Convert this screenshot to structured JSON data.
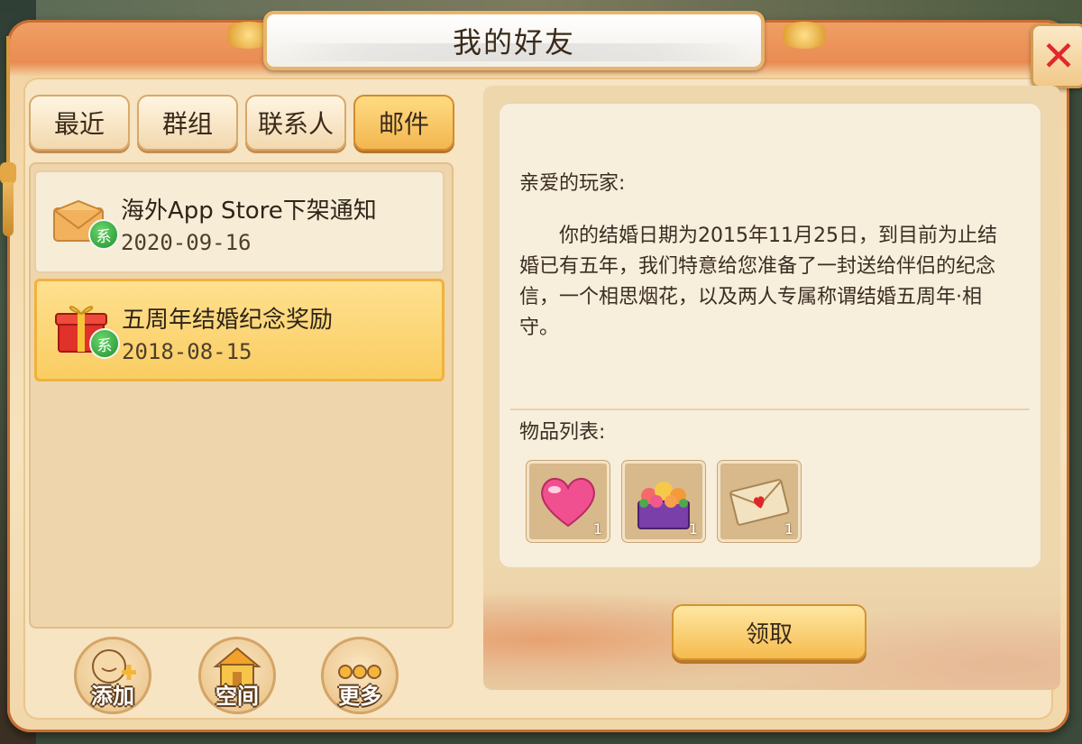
{
  "window": {
    "title": "我的好友"
  },
  "tabs": [
    {
      "label": "最近",
      "active": false
    },
    {
      "label": "群组",
      "active": false
    },
    {
      "label": "联系人",
      "active": false
    },
    {
      "label": "邮件",
      "active": true
    }
  ],
  "mails": [
    {
      "subject": "海外App Store下架通知",
      "date": "2020-09-16",
      "icon": "envelope-icon",
      "badge": "系",
      "selected": false
    },
    {
      "subject": "五周年结婚纪念奖励",
      "date": "2018-08-15",
      "icon": "gift-box-icon",
      "badge": "系",
      "selected": true
    }
  ],
  "bottom_buttons": [
    {
      "label": "添加",
      "icon": "add-friend-icon"
    },
    {
      "label": "空间",
      "icon": "house-icon"
    },
    {
      "label": "更多",
      "icon": "more-dots-icon"
    }
  ],
  "detail": {
    "greeting": "亲爱的玩家:",
    "body": "你的结婚日期为2015年11月25日，到目前为止结婚已有五年，我们特意给您准备了一封送给伴侣的纪念信，一个相思烟花，以及两人专属称谓结婚五周年·相守。",
    "items_label": "物品列表:",
    "items": [
      {
        "icon": "pink-heart-icon",
        "qty": "1"
      },
      {
        "icon": "flower-box-icon",
        "qty": "1"
      },
      {
        "icon": "love-letter-icon",
        "qty": "1"
      }
    ],
    "claim_label": "领取"
  },
  "colors": {
    "accent": "#f5bb4e",
    "badge_green": "#1f8f2e",
    "close_red": "#e3262a"
  }
}
